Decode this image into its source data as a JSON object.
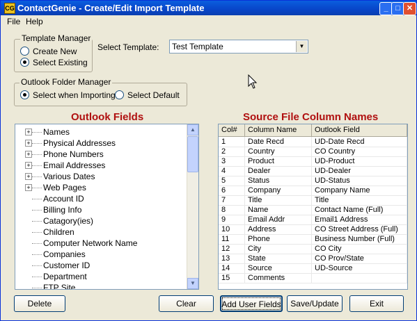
{
  "window": {
    "title": "ContactGenie - Create/Edit Import Template",
    "icon_text": "CG"
  },
  "menu": {
    "items": [
      "File",
      "Help"
    ]
  },
  "template_manager": {
    "label": "Template Manager",
    "options": [
      "Create New",
      "Select Existing"
    ],
    "selected": "Select Existing"
  },
  "select_template": {
    "label": "Select Template:",
    "value": "Test Template"
  },
  "outlook_folder_manager": {
    "label": "Outlook Folder Manager",
    "options": [
      "Select when Importing",
      "Select Default"
    ],
    "selected": "Select when Importing"
  },
  "outlook_fields": {
    "heading": "Outlook Fields",
    "items": [
      {
        "label": "Names",
        "expandable": true
      },
      {
        "label": "Physical Addresses",
        "expandable": true
      },
      {
        "label": "Phone Numbers",
        "expandable": true
      },
      {
        "label": "Email Addresses",
        "expandable": true
      },
      {
        "label": "Various Dates",
        "expandable": true
      },
      {
        "label": "Web Pages",
        "expandable": true
      },
      {
        "label": "Account ID",
        "expandable": false
      },
      {
        "label": "Billing Info",
        "expandable": false
      },
      {
        "label": "Catagory(ies)",
        "expandable": false
      },
      {
        "label": "Children",
        "expandable": false
      },
      {
        "label": "Computer Network Name",
        "expandable": false
      },
      {
        "label": "Companies",
        "expandable": false
      },
      {
        "label": "Customer ID",
        "expandable": false
      },
      {
        "label": "Department",
        "expandable": false
      },
      {
        "label": "FTP Site",
        "expandable": false
      }
    ]
  },
  "source_columns": {
    "heading": "Source File Column Names",
    "headers": [
      "Col#",
      "Column Name",
      "Outlook Field"
    ],
    "rows": [
      [
        "1",
        "Date Recd",
        "UD-Date Recd"
      ],
      [
        "2",
        "Country",
        "CO Country"
      ],
      [
        "3",
        "Product",
        "UD-Product"
      ],
      [
        "4",
        "Dealer",
        "UD-Dealer"
      ],
      [
        "5",
        "Status",
        "UD-Status"
      ],
      [
        "6",
        "Company",
        "Company Name"
      ],
      [
        "7",
        "Title",
        "Title"
      ],
      [
        "8",
        "Name",
        "Contact Name (Full)"
      ],
      [
        "9",
        "Email Addr",
        "Email1 Address"
      ],
      [
        "10",
        "Address",
        "CO Street Address (Full)"
      ],
      [
        "11",
        "Phone",
        "Business Number (Full)"
      ],
      [
        "12",
        "City",
        "CO City"
      ],
      [
        "13",
        "State",
        "CO Prov/State"
      ],
      [
        "14",
        "Source",
        "UD-Source"
      ],
      [
        "15",
        "Comments",
        ""
      ]
    ]
  },
  "buttons": {
    "delete": "Delete",
    "clear": "Clear",
    "add_user_fields": "Add User Fields",
    "save_update": "Save/Update",
    "exit": "Exit"
  }
}
